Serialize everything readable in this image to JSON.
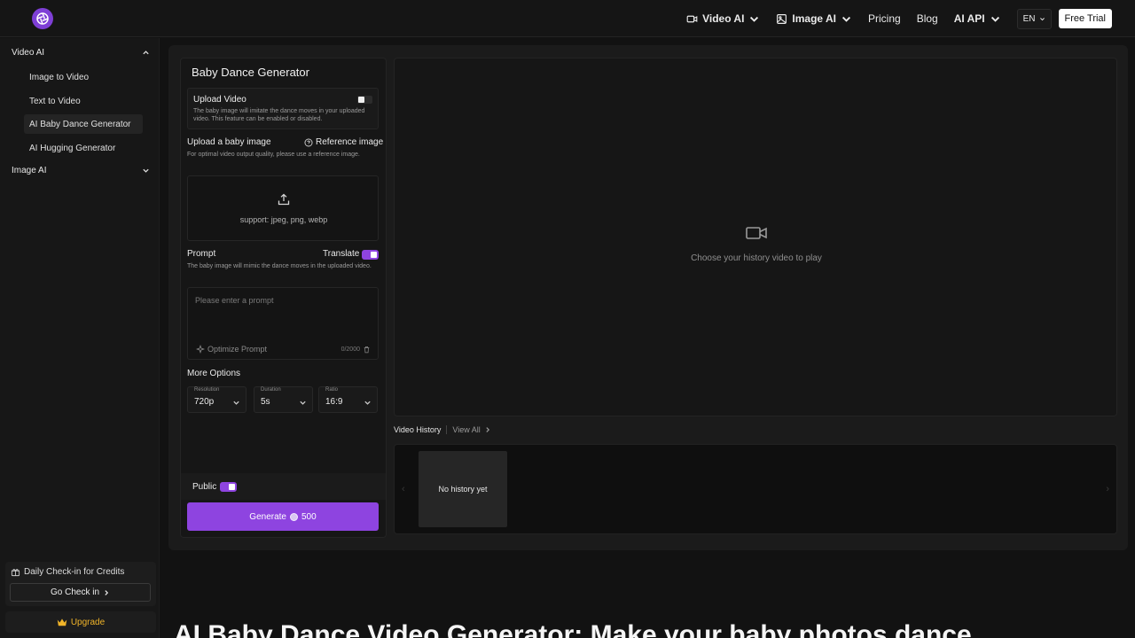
{
  "nav": {
    "video_ai": "Video AI",
    "image_ai": "Image AI",
    "pricing": "Pricing",
    "blog": "Blog",
    "ai_api": "AI API",
    "lang": "EN",
    "free_trial": "Free Trial"
  },
  "sidebar": {
    "group_video": "Video AI",
    "items": [
      "Image to Video",
      "Text to Video",
      "AI Baby Dance Generator",
      "AI Hugging Generator"
    ],
    "group_image": "Image AI",
    "checkin_title": "Daily Check-in for Credits",
    "checkin_btn": "Go Check in",
    "upgrade": "Upgrade"
  },
  "form": {
    "title": "Baby Dance Generator",
    "upload_video_label": "Upload Video",
    "upload_video_desc": "The baby image will imitate the dance moves in your uploaded video. This feature can be enabled or disabled.",
    "upload_baby_label": "Upload a baby image",
    "reference": "Reference image",
    "upload_baby_desc": "For optimal video output quality, please use a reference image.",
    "support": "support: jpeg, png, webp",
    "prompt_label": "Prompt",
    "translate": "Translate",
    "prompt_desc": "The baby image will mimic the dance moves in the uploaded video.",
    "prompt_placeholder": "Please enter a prompt",
    "optimize": "Optimize Prompt",
    "counter": "0/2000",
    "more_options": "More Options",
    "resolution_cap": "Resolution",
    "resolution_val": "720p",
    "duration_cap": "Duration",
    "duration_val": "5s",
    "ratio_cap": "Ratio",
    "ratio_val": "16:9",
    "public": "Public",
    "generate": "Generate",
    "credits": "500"
  },
  "preview": {
    "message": "Choose your history video to play"
  },
  "history": {
    "title": "Video History",
    "view_all": "View All",
    "empty": "No history yet"
  },
  "page": {
    "heading": "AI Baby Dance Video Generator: Make your baby photos dance"
  },
  "colors": {
    "accent": "#8e44e0",
    "background": "#121212"
  }
}
